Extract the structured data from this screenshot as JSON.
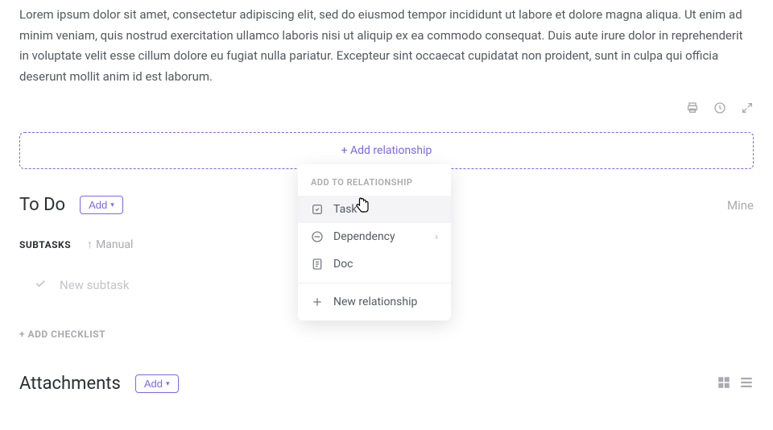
{
  "description": "Lorem ipsum dolor sit amet, consectetur adipiscing elit, sed do eiusmod tempor incididunt ut labore et dolore magna aliqua. Ut enim ad minim veniam, quis nostrud exercitation ullamco laboris nisi ut aliquip ex ea commodo consequat. Duis aute irure dolor in reprehenderit in voluptate velit esse cillum dolore eu fugiat nulla pariatur. Excepteur sint occaecat cupidatat non proident, sunt in culpa qui officia deserunt mollit anim id est laborum.",
  "addRelationship": "+ Add relationship",
  "todo": {
    "title": "To Do",
    "addButton": "Add",
    "mine": "Mine"
  },
  "subtasks": {
    "label": "SUBTASKS",
    "sort": "Manual",
    "placeholder": "New subtask"
  },
  "addChecklist": "+ ADD CHECKLIST",
  "attachments": {
    "title": "Attachments",
    "addButton": "Add"
  },
  "popup": {
    "header": "ADD TO RELATIONSHIP",
    "items": {
      "task": "Task",
      "dependency": "Dependency",
      "doc": "Doc",
      "new": "New relationship"
    }
  }
}
